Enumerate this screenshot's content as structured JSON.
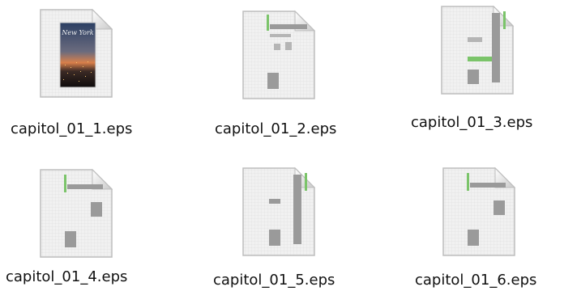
{
  "window": {
    "background": "#ffffff"
  },
  "files": [
    {
      "name": "capitol_01_1.eps",
      "icon": "eps-document-photo-icon",
      "preview_text": "New York"
    },
    {
      "name": "capitol_01_2.eps",
      "icon": "eps-document-layout-icon"
    },
    {
      "name": "capitol_01_3.eps",
      "icon": "eps-document-layout-icon"
    },
    {
      "name": "capitol_01_4.eps",
      "icon": "eps-document-layout-icon"
    },
    {
      "name": "capitol_01_5.eps",
      "icon": "eps-document-layout-icon"
    },
    {
      "name": "capitol_01_6.eps",
      "icon": "eps-document-layout-icon"
    }
  ]
}
